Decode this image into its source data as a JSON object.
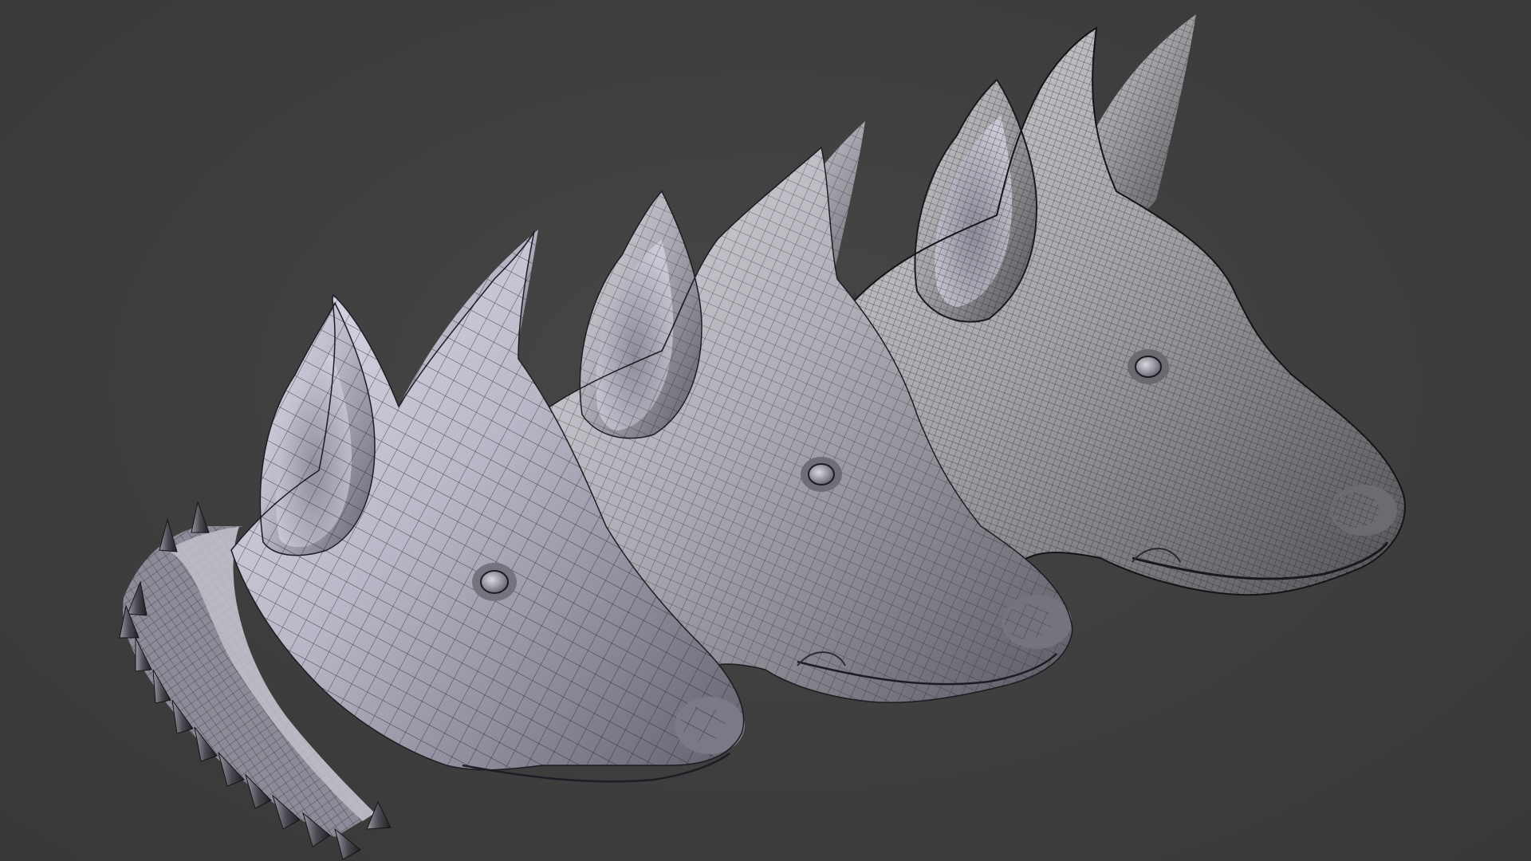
{
  "viewport": {
    "background": "#3c3c3c",
    "description_hidden": ""
  },
  "models": [
    {
      "id": "low-poly-head",
      "has_collar": true,
      "wire_color": "#1c1c24",
      "shade_light": "#d8d8e6",
      "shade_dark": "#5c5c6a"
    },
    {
      "id": "mid-poly-head",
      "has_collar": true,
      "wire_color": "#1c1c22",
      "shade_light": "#d6d6dc",
      "shade_dark": "#5a5a62"
    },
    {
      "id": "high-poly-head",
      "has_collar": true,
      "wire_color": "#141416",
      "shade_light": "#cfcfd2",
      "shade_dark": "#505054"
    }
  ]
}
